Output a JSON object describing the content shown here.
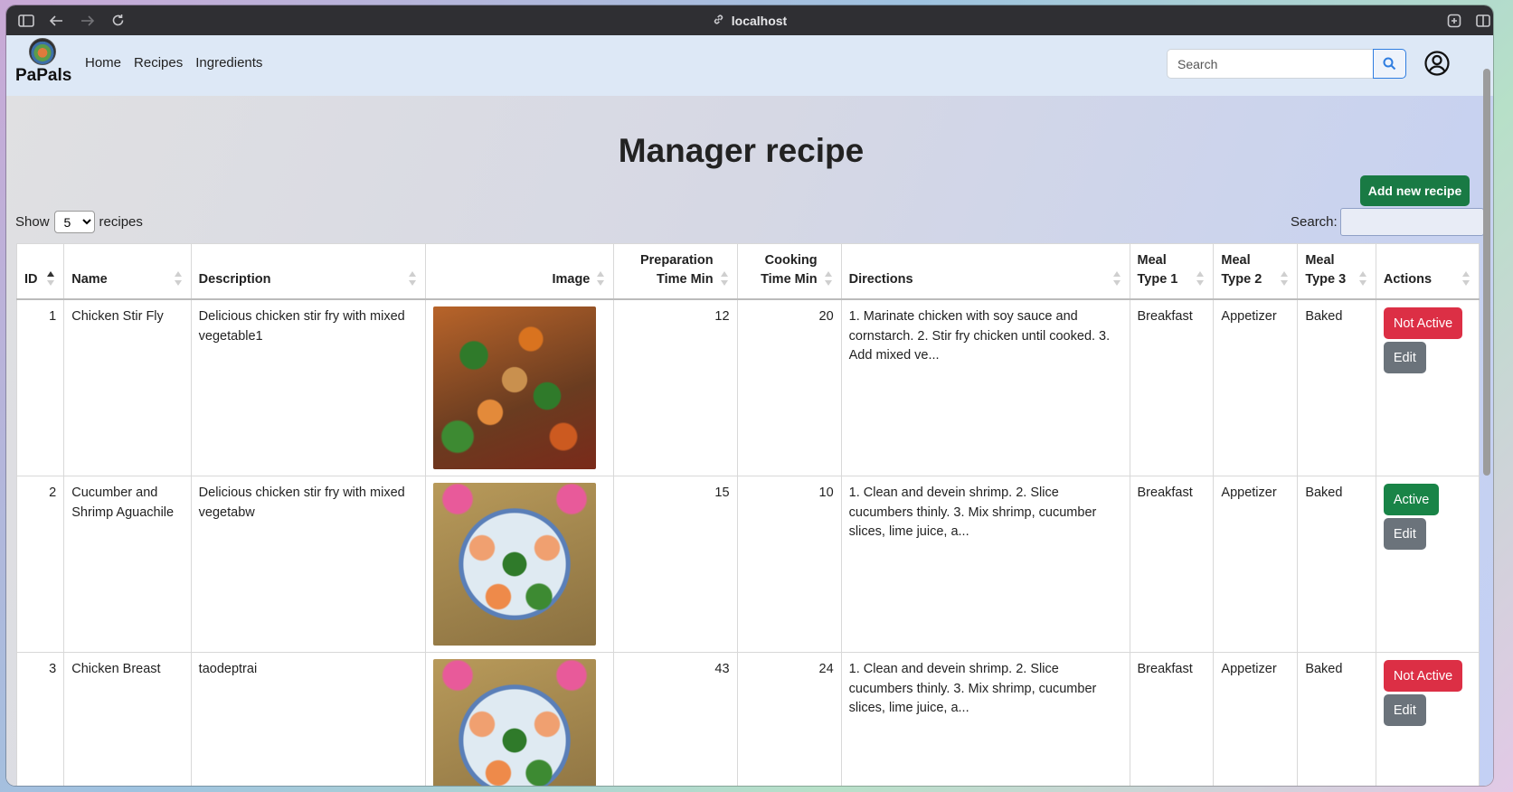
{
  "browser": {
    "url": "localhost"
  },
  "navbar": {
    "brand": "PaPals",
    "links": [
      "Home",
      "Recipes",
      "Ingredients"
    ],
    "search_placeholder": "Search"
  },
  "page": {
    "title": "Manager recipe",
    "add_button": "Add new recipe",
    "show_label": "Show",
    "show_value": "5",
    "show_suffix": "recipes",
    "search_label": "Search:"
  },
  "table": {
    "headers": {
      "id": "ID",
      "name": "Name",
      "description": "Description",
      "image": "Image",
      "prep_line1": "Preparation",
      "prep_line2": "Time Min",
      "cook_line1": "Cooking",
      "cook_line2": "Time Min",
      "directions": "Directions",
      "meal1_line1": "Meal",
      "meal1_line2": "Type 1",
      "meal2_line1": "Meal",
      "meal2_line2": "Type 2",
      "meal3_line1": "Meal",
      "meal3_line2": "Type 3",
      "actions": "Actions"
    },
    "rows": [
      {
        "id": "1",
        "name": "Chicken Stir Fly",
        "description": "Delicious chicken stir fry with mixed vegetable1",
        "prep": "12",
        "cook": "20",
        "directions": "1. Marinate chicken with soy sauce and cornstarch. 2. Stir fry chicken until cooked. 3. Add mixed ve...",
        "meal1": "Breakfast",
        "meal2": "Appetizer",
        "meal3": "Baked",
        "status": "Not Active",
        "edit": "Edit"
      },
      {
        "id": "2",
        "name": "Cucumber and Shrimp Aguachile",
        "description": "Delicious chicken stir fry with mixed vegetabw",
        "prep": "15",
        "cook": "10",
        "directions": "1. Clean and devein shrimp. 2. Slice cucumbers thinly. 3. Mix shrimp, cucumber slices, lime juice, a...",
        "meal1": "Breakfast",
        "meal2": "Appetizer",
        "meal3": "Baked",
        "status": "Active",
        "edit": "Edit"
      },
      {
        "id": "3",
        "name": "Chicken Breast",
        "description": "taodeptrai",
        "prep": "43",
        "cook": "24",
        "directions": "1. Clean and devein shrimp. 2. Slice cucumbers thinly. 3. Mix shrimp, cucumber slices, lime juice, a...",
        "meal1": "Breakfast",
        "meal2": "Appetizer",
        "meal3": "Baked",
        "status": "Not Active",
        "edit": "Edit"
      }
    ]
  },
  "colors": {
    "active": "#198447",
    "not_active": "#dc2f45",
    "edit": "#6b737b",
    "add": "#197a44"
  }
}
